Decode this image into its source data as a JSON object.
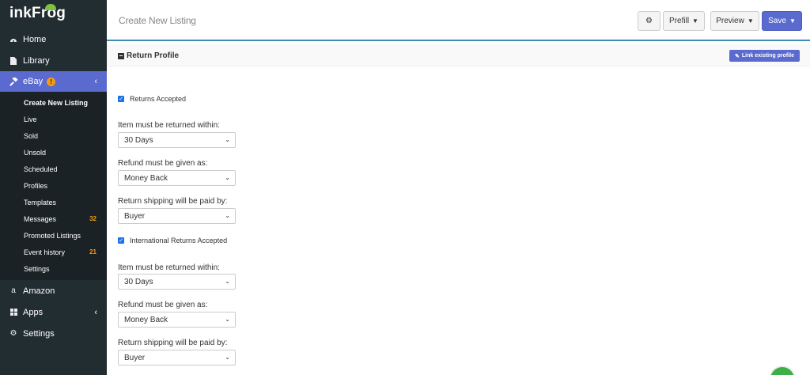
{
  "brand": {
    "name": "inkFrog"
  },
  "sidebar": {
    "items": [
      {
        "label": "Home",
        "icon": "dashboard-icon"
      },
      {
        "label": "Library",
        "icon": "file-icon"
      },
      {
        "label": "eBay",
        "icon": "gavel-icon",
        "active": true
      }
    ],
    "ebay_sub": [
      {
        "label": "Create New Listing",
        "current": true,
        "count": ""
      },
      {
        "label": "Live",
        "count": ""
      },
      {
        "label": "Sold",
        "count": ""
      },
      {
        "label": "Unsold",
        "count": ""
      },
      {
        "label": "Scheduled",
        "count": ""
      },
      {
        "label": "Profiles",
        "count": ""
      },
      {
        "label": "Templates",
        "count": ""
      },
      {
        "label": "Messages",
        "count": "32"
      },
      {
        "label": "Promoted Listings",
        "count": ""
      },
      {
        "label": "Event history",
        "count": "21"
      },
      {
        "label": "Settings",
        "count": ""
      }
    ],
    "bottom_items": [
      {
        "label": "Amazon",
        "icon": "amazon-icon"
      },
      {
        "label": "Apps",
        "icon": "apps-icon"
      },
      {
        "label": "Settings",
        "icon": "gear-icon"
      }
    ]
  },
  "header": {
    "title": "Create New Listing",
    "prefill_label": "Prefill",
    "preview_label": "Preview",
    "save_label": "Save"
  },
  "panel": {
    "title": "Return Profile",
    "link_label": "Link existing profile"
  },
  "domestic": {
    "checkbox_label": "Returns Accepted",
    "checked": true,
    "within_label": "Item must be returned within:",
    "within_value": "30 Days",
    "refund_label": "Refund must be given as:",
    "refund_value": "Money Back",
    "shipping_label": "Return shipping will be paid by:",
    "shipping_value": "Buyer"
  },
  "international": {
    "checkbox_label": "International Returns Accepted",
    "checked": true,
    "within_label": "Item must be returned within:",
    "within_value": "30 Days",
    "refund_label": "Refund must be given as:",
    "refund_value": "Money Back",
    "shipping_label": "Return shipping will be paid by:",
    "shipping_value": "Buyer"
  },
  "colors": {
    "sidebar_bg": "#222d32",
    "accent": "#5a6acf",
    "warning": "#f39c12",
    "topbar_border": "#3c8dbc"
  }
}
